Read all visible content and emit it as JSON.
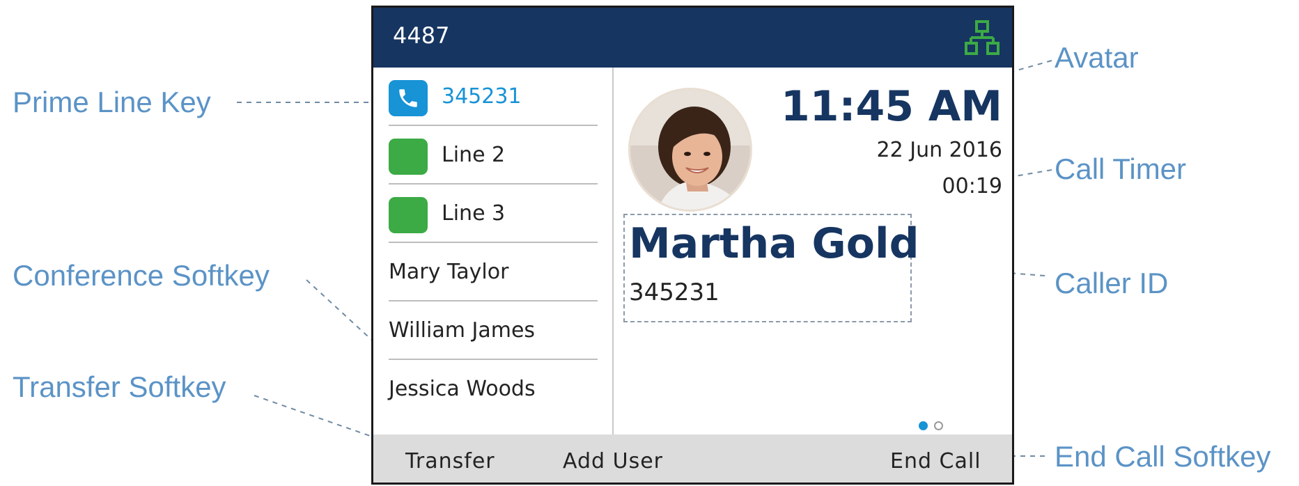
{
  "header": {
    "extension": "4487",
    "network_icon": "network-icon"
  },
  "lines": [
    {
      "label": "345231",
      "icon": "phone-icon",
      "key_color": "#1793d6",
      "active": true
    },
    {
      "label": "Line 2",
      "key_color": "#3caa45"
    },
    {
      "label": "Line 3",
      "key_color": "#3caa45"
    },
    {
      "label": "Mary Taylor"
    },
    {
      "label": "William James"
    },
    {
      "label": "Jessica Woods"
    }
  ],
  "call": {
    "time": "11:45 AM",
    "date": "22 Jun 2016",
    "timer": "00:19",
    "caller_name": "Martha Gold",
    "caller_number": "345231",
    "page_indicator": {
      "current": 1,
      "total": 2
    }
  },
  "softkeys": {
    "transfer": "Transfer",
    "add_user": "Add User",
    "end_call": "End Call"
  },
  "callouts": {
    "prime_line_key": "Prime Line Key",
    "conference_softkey": "Conference Softkey",
    "transfer_softkey": "Transfer Softkey",
    "avatar": "Avatar",
    "call_timer": "Call Timer",
    "caller_id": "Caller ID",
    "end_call_softkey": "End Call Softkey"
  },
  "colors": {
    "header_bg": "#163561",
    "accent_blue": "#1793d6",
    "line_green": "#3caa45",
    "callout_text": "#5b93c6",
    "softkey_bar": "#dcdcdc"
  }
}
